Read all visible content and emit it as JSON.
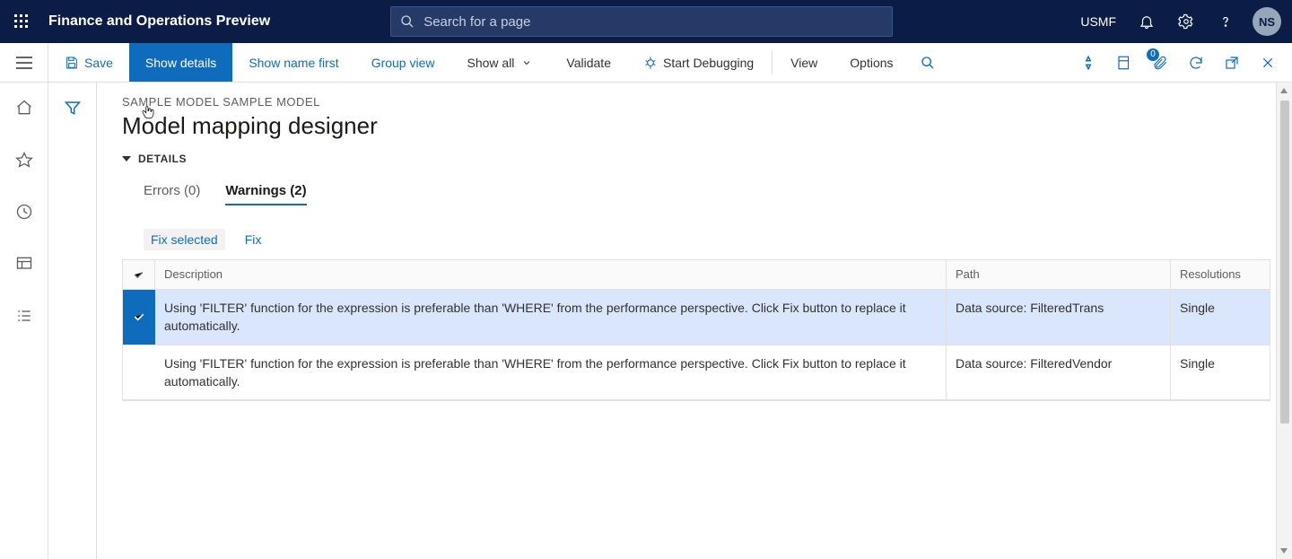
{
  "topbar": {
    "brand": "Finance and Operations Preview",
    "search_placeholder": "Search for a page",
    "company": "USMF",
    "avatar_initials": "NS"
  },
  "cmdbar": {
    "save": "Save",
    "show_details": "Show details",
    "show_name_first": "Show name first",
    "group_view": "Group view",
    "show_all": "Show all",
    "validate": "Validate",
    "start_debugging": "Start Debugging",
    "view": "View",
    "options": "Options",
    "attachment_badge": "0"
  },
  "page": {
    "breadcrumb": "SAMPLE MODEL SAMPLE MODEL",
    "title": "Model mapping designer",
    "section": "DETAILS"
  },
  "tabs": {
    "errors_label": "Errors (0)",
    "warnings_label": "Warnings (2)"
  },
  "actions": {
    "fix_selected": "Fix selected",
    "fix": "Fix"
  },
  "grid": {
    "headers": {
      "description": "Description",
      "path": "Path",
      "resolutions": "Resolutions"
    },
    "rows": [
      {
        "selected": true,
        "description": "Using 'FILTER' function for the expression is preferable than 'WHERE' from the performance perspective. Click Fix button to replace it automatically.",
        "path": "Data source: FilteredTrans",
        "resolutions": "Single"
      },
      {
        "selected": false,
        "description": "Using 'FILTER' function for the expression is preferable than 'WHERE' from the performance perspective. Click Fix button to replace it automatically.",
        "path": "Data source: FilteredVendor",
        "resolutions": "Single"
      }
    ]
  }
}
